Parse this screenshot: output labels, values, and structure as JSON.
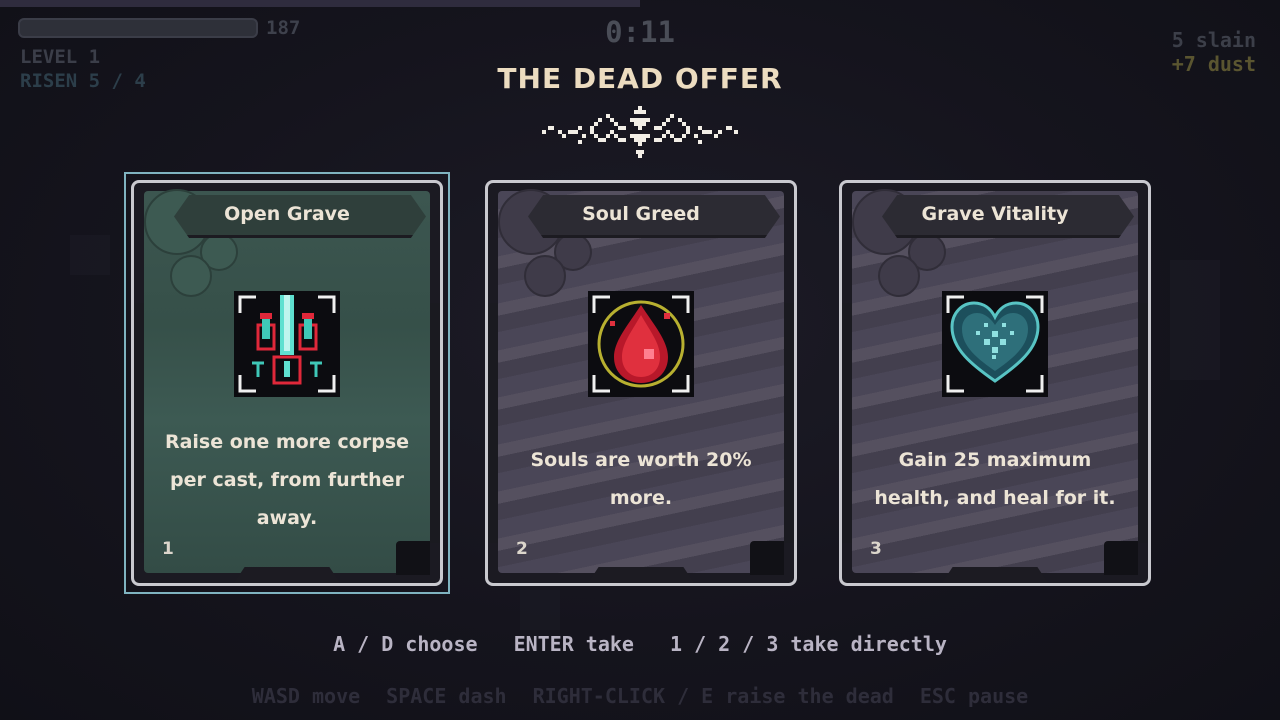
{
  "hud": {
    "xp_value": "187",
    "xp_progress": 0.0,
    "level": "LEVEL 1",
    "risen": "RISEN 5 / 4",
    "timer": "0:11",
    "slain": "5 slain",
    "dust": "+7 dust"
  },
  "offer": {
    "title": "THE DEAD OFFER",
    "selected_index": 0,
    "cards": [
      {
        "name": "Open Grave",
        "description": "Raise one more corpse per cast, from further away.",
        "number": "1",
        "icon": "open-grave-icon"
      },
      {
        "name": "Soul Greed",
        "description": "Souls are worth 20% more.",
        "number": "2",
        "icon": "blood-drop-icon"
      },
      {
        "name": "Grave Vitality",
        "description": "Gain 25 maximum health, and heal for it.",
        "number": "3",
        "icon": "heart-icon"
      }
    ]
  },
  "hints": {
    "choose": "A / D choose",
    "take": "ENTER take",
    "direct": "1 / 2 / 3 take directly"
  },
  "controls": {
    "move": "WASD move",
    "dash": "SPACE dash",
    "raise": "RIGHT-CLICK / E raise the dead",
    "pause": "ESC pause"
  },
  "colors": {
    "selection_border": "#7fb3c0",
    "title": "#ecdcc0",
    "dust": "#5a5530"
  }
}
